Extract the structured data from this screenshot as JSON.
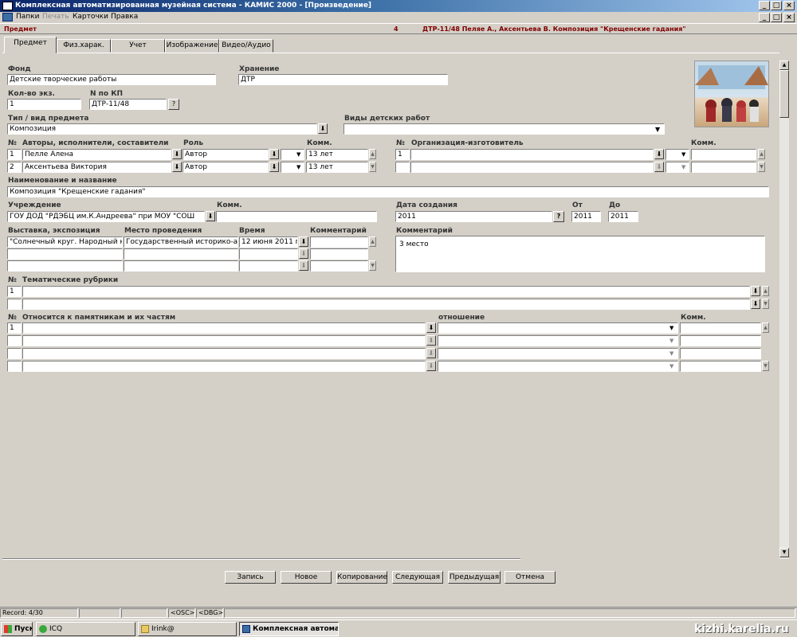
{
  "window": {
    "title": "Комплексная автоматизированная музейная система - КАМИС 2000 - [Произведение]"
  },
  "menu": {
    "items": [
      "Папки",
      "Печать",
      "Карточки",
      "Правка"
    ]
  },
  "header": {
    "section": "Предмет",
    "count": "4",
    "record_title": "ДТР-11/48 Пеляе А., Аксентьева В.  Композиция \"Крещенские гадания\""
  },
  "tabs": [
    "Предмет",
    "Физ.харак.",
    "Учет",
    "Изображение",
    "Видео/Аудио"
  ],
  "form": {
    "fond": {
      "label": "Фонд",
      "value": "Детские творческие работы"
    },
    "storage": {
      "label": "Хранение",
      "value": "ДТР"
    },
    "qty": {
      "label": "Кол-во экз.",
      "value": "1"
    },
    "kp": {
      "label": "N  по КП",
      "value": "ДТР-11/48",
      "btn": "?"
    },
    "type": {
      "label": "Тип / вид предмета",
      "value": "Композиция"
    },
    "kinds": {
      "label": "Виды детских работ",
      "value": ""
    },
    "authors": {
      "no_label": "№",
      "label": "Авторы, исполнители, составители",
      "role_label": "Роль",
      "comm_label": "Комм.",
      "rows": [
        {
          "no": "1",
          "name": "Пелле Алена",
          "role": "Автор",
          "comm": "13 лет"
        },
        {
          "no": "2",
          "name": "Аксентьева Виктория",
          "role": "Автор",
          "comm": "13 лет"
        }
      ]
    },
    "org": {
      "no_label": "№",
      "label": "Организация-изготовитель",
      "comm_label": "Комм.",
      "rows": [
        {
          "no": "1"
        },
        {
          "no": ""
        }
      ]
    },
    "name": {
      "label": "Наименование и название",
      "value": "Композиция \"Крещенские гадания\""
    },
    "institution": {
      "label": "Учреждение",
      "value": "ГОУ ДОД \"РДЭБЦ им.К.Андреева\"  при МОУ \"СОШ",
      "comm_label": "Комм."
    },
    "created": {
      "label": "Дата создания",
      "value": "2011",
      "btn": "?",
      "from_label": "От",
      "from": "2011",
      "to_label": "До",
      "to": "2011"
    },
    "exhibition": {
      "label": "Выставка, экспозиция",
      "place_label": "Место проведения",
      "time_label": "Время",
      "comment_label": "Комментарий",
      "rows": [
        {
          "expo": "\"Солнечный круг. Народный ка",
          "place": "Государственный историко-ар",
          "time": "12 июня 2011 г."
        },
        {
          "expo": "",
          "place": "",
          "time": ""
        },
        {
          "expo": "",
          "place": "",
          "time": ""
        }
      ]
    },
    "comment": {
      "label": "Комментарий",
      "value": "3 место"
    },
    "rubrics": {
      "no_label": "№",
      "label": "Тематические рубрики",
      "rows": [
        {
          "no": "1"
        },
        {
          "no": ""
        }
      ]
    },
    "monuments": {
      "no_label": "№",
      "label": "Относится к памятникам и их частям",
      "rel_label": "отношение",
      "comm_label": "Комм.",
      "rows": [
        {
          "no": "1"
        },
        {
          "no": ""
        },
        {
          "no": ""
        },
        {
          "no": ""
        }
      ]
    }
  },
  "buttons": [
    "Запись",
    "Новое",
    "Копирование",
    "Следующая",
    "Предыдущая",
    "Отмена"
  ],
  "status": {
    "record": "Record: 4/30",
    "osc": "<OSC>",
    "dbg": "<DBG>"
  },
  "taskbar": {
    "start": "Пуск",
    "items": [
      "ICQ",
      "Irink@",
      "Комплексная автома..."
    ],
    "watermark": "kizhi.karelia.ru"
  }
}
